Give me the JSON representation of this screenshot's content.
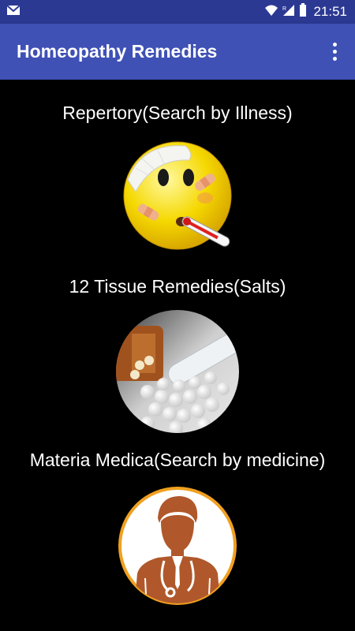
{
  "status_bar": {
    "time": "21:51",
    "icons": [
      "gmail-icon",
      "wifi-icon",
      "signal-icon",
      "battery-icon"
    ]
  },
  "app_bar": {
    "title": "Homeopathy Remedies",
    "overflow_icon": "more-vertical-icon"
  },
  "menu": [
    {
      "label": "Repertory(Search by Illness)",
      "icon": "sick-emoji-icon"
    },
    {
      "label": "12 Tissue Remedies(Salts)",
      "icon": "pills-icon"
    },
    {
      "label": "Materia Medica(Search by medicine)",
      "icon": "doctor-icon"
    }
  ],
  "colors": {
    "status_bar": "#2c3993",
    "app_bar": "#3f51b5",
    "background": "#000000",
    "doctor_ring": "#f0a020",
    "doctor_figure": "#b0582b"
  }
}
